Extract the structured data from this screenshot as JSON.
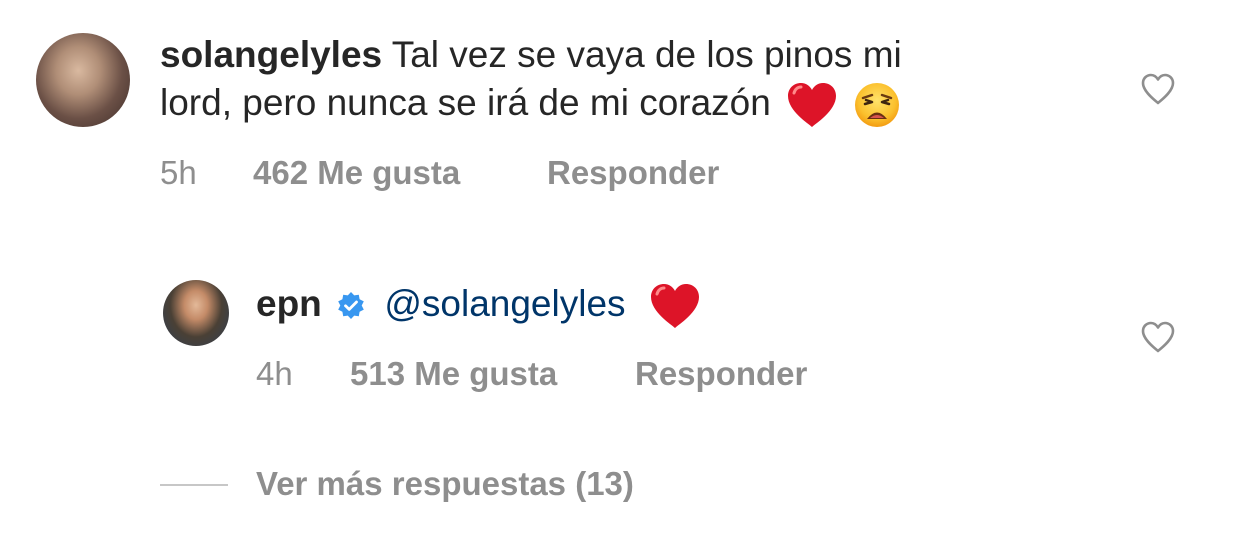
{
  "comments": [
    {
      "username": "solangelyles",
      "text_line1": "Tal vez se vaya de los pinos mi",
      "text_line2": "lord, pero nunca se irá de mi corazón",
      "emojis": [
        "red-heart",
        "weary-face"
      ],
      "time": "5h",
      "likes": "462 Me gusta",
      "reply_label": "Responder",
      "liked": false
    },
    {
      "username": "epn",
      "verified": true,
      "mention": "@solangelyles",
      "emojis": [
        "red-heart"
      ],
      "time": "4h",
      "likes": "513 Me gusta",
      "reply_label": "Responder",
      "liked": false
    }
  ],
  "more_replies_label": "Ver más respuestas (13)",
  "colors": {
    "text": "#262626",
    "meta": "#8e8e8e",
    "mention": "#003569",
    "verified": "#3897f0",
    "heart": "#e0162b"
  }
}
